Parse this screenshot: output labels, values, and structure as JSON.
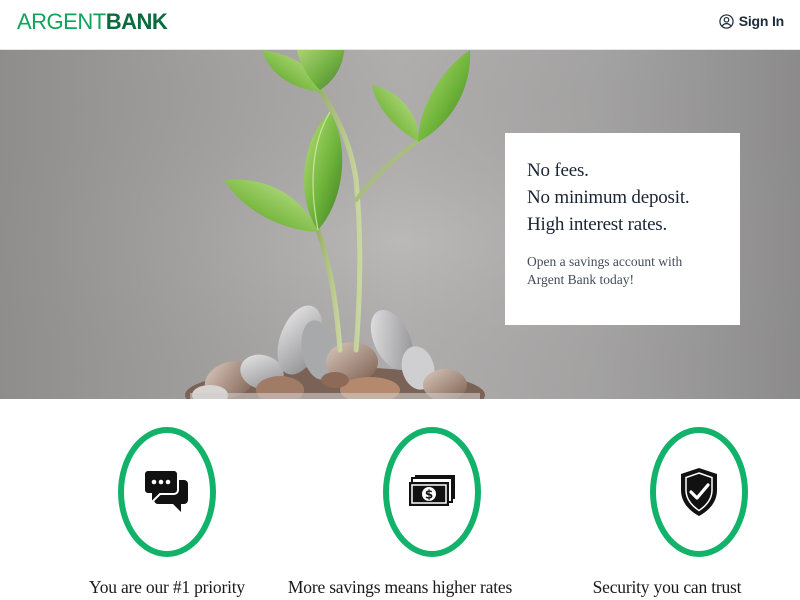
{
  "brand": {
    "logo_light": "ARGENT",
    "logo_bold": "BANK",
    "color": "#11a35a"
  },
  "header": {
    "signin_label": "Sign In",
    "signin_icon": "user-circle-icon"
  },
  "hero": {
    "headline": [
      "No fees.",
      "No minimum deposit.",
      "High interest rates."
    ],
    "subtext": "Open a savings account with Argent Bank today!"
  },
  "features": [
    {
      "icon": "chat-icon",
      "title": "You are our #1 priority"
    },
    {
      "icon": "money-icon",
      "title": "More savings means higher rates"
    },
    {
      "icon": "security-shield-icon",
      "title": "Security you can trust"
    }
  ],
  "colors": {
    "accent": "#12b26a",
    "text": "#1a2433"
  }
}
